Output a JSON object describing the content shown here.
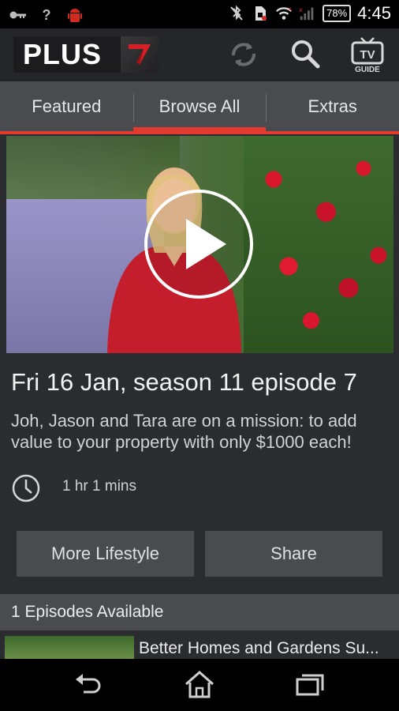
{
  "status_bar": {
    "battery": "78%",
    "time": "4:45",
    "left_icons": [
      "key-icon",
      "question-icon",
      "android-icon"
    ],
    "right_icons": [
      "bluetooth-off-icon",
      "sim-icon",
      "wifi-icon",
      "signal-icon",
      "battery-icon"
    ]
  },
  "app_bar": {
    "logo_text": "PLUS",
    "tv_guide_label": "GUIDE",
    "tv_label": "TV",
    "colors": {
      "accent": "#e23a2e",
      "bar": "#25262a"
    }
  },
  "tabs": [
    {
      "label": "Featured",
      "active": false
    },
    {
      "label": "Browse All",
      "active": true
    },
    {
      "label": "Extras",
      "active": false
    }
  ],
  "episode": {
    "title": "Fri 16 Jan, season 11 episode 7",
    "description": "Joh, Jason and Tara are on a mission: to add value to your property with only $1000 each!",
    "duration": "1 hr 1 mins"
  },
  "buttons": {
    "more": "More Lifestyle",
    "share": "Share"
  },
  "episodes": {
    "header": "1 Episodes Available",
    "items": [
      {
        "title": "Better Homes and Gardens Su..."
      }
    ]
  }
}
